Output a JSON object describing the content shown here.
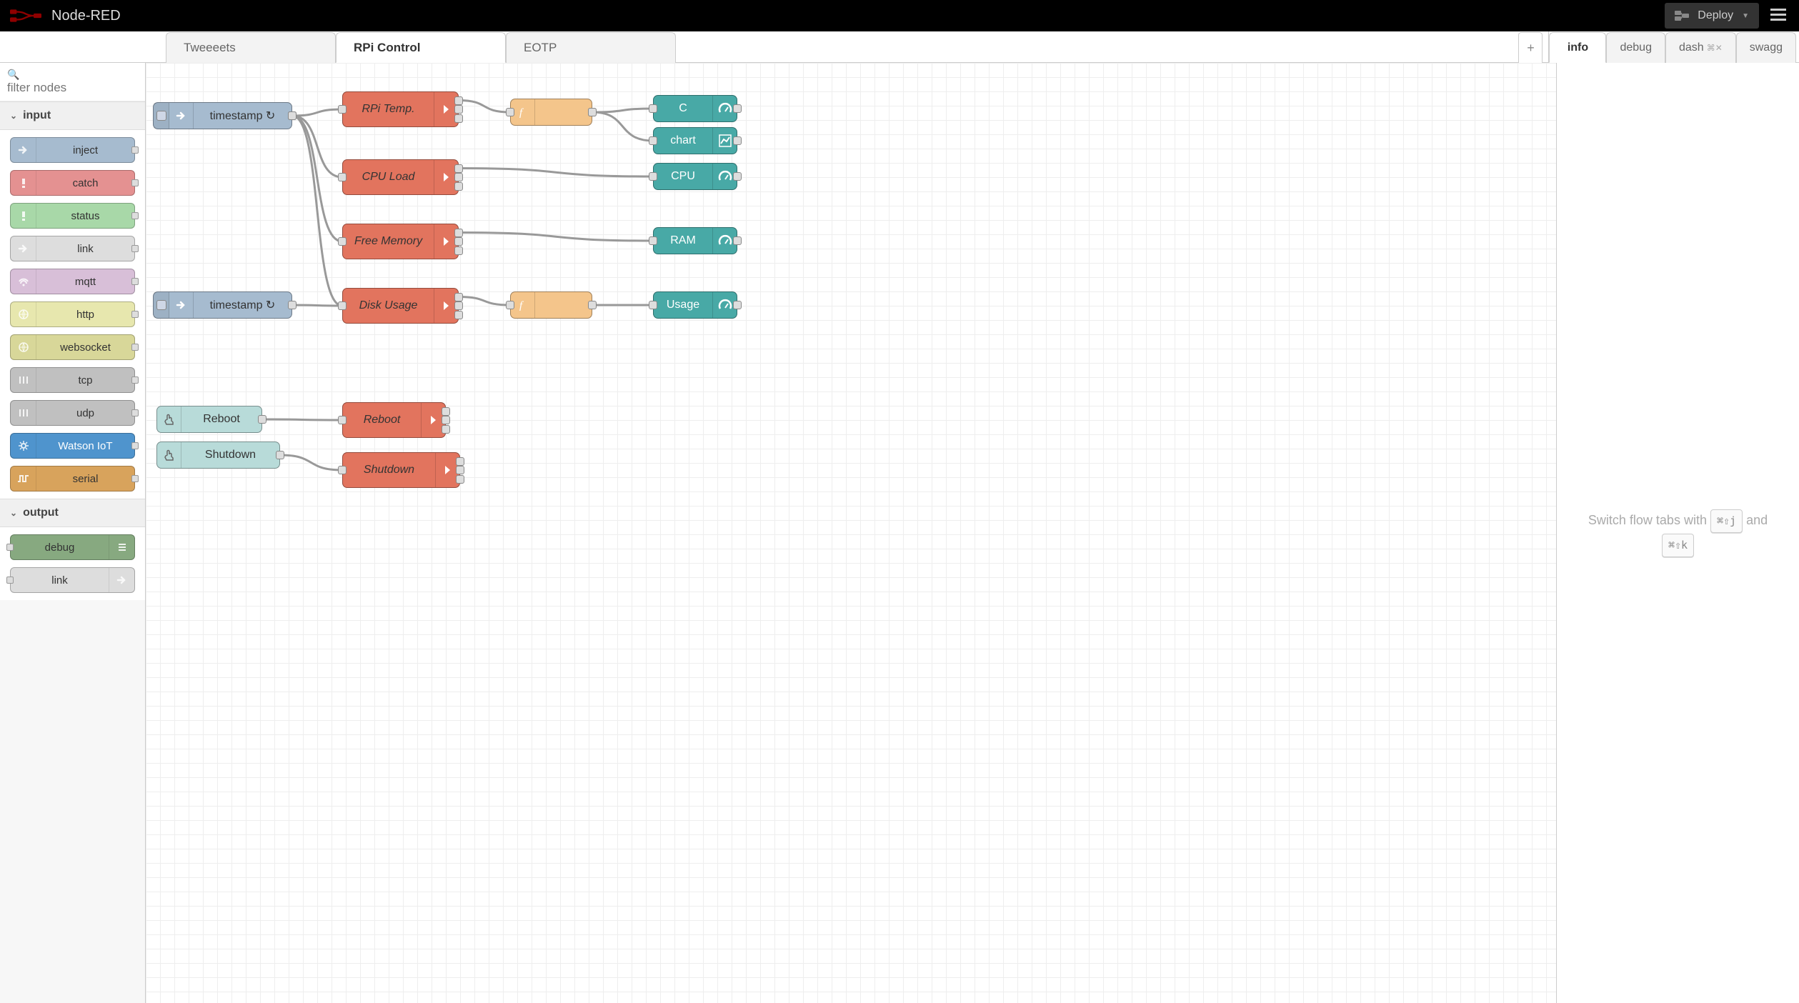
{
  "header": {
    "app_title": "Node-RED",
    "deploy_label": "Deploy"
  },
  "tabs": [
    {
      "label": "Tweeeets",
      "active": false
    },
    {
      "label": "RPi Control",
      "active": true
    },
    {
      "label": "EOTP",
      "active": false
    }
  ],
  "sidebar_tabs": [
    {
      "label": "info",
      "active": true,
      "closable": false
    },
    {
      "label": "debug",
      "active": false,
      "closable": false
    },
    {
      "label": "dash",
      "active": false,
      "closable": true
    },
    {
      "label": "swagg",
      "active": false,
      "closable": false
    }
  ],
  "palette": {
    "filter_placeholder": "filter nodes",
    "categories": [
      {
        "label": "input",
        "items": [
          {
            "label": "inject",
            "color": "c-inject",
            "icon": "arrow",
            "port": "out"
          },
          {
            "label": "catch",
            "color": "c-catch",
            "icon": "bang",
            "port": "out"
          },
          {
            "label": "status",
            "color": "c-status",
            "icon": "bang",
            "port": "out"
          },
          {
            "label": "link",
            "color": "c-link",
            "icon": "arrow",
            "port": "out"
          },
          {
            "label": "mqtt",
            "color": "c-mqtt",
            "icon": "wifi",
            "port": "out"
          },
          {
            "label": "http",
            "color": "c-http",
            "icon": "globe",
            "port": "out"
          },
          {
            "label": "websocket",
            "color": "c-ws",
            "icon": "globe",
            "port": "out"
          },
          {
            "label": "tcp",
            "color": "c-tcp",
            "icon": "net",
            "port": "out"
          },
          {
            "label": "udp",
            "color": "c-udp",
            "icon": "net",
            "port": "out"
          },
          {
            "label": "Watson IoT",
            "color": "c-watson",
            "icon": "gear",
            "port": "out"
          },
          {
            "label": "serial",
            "color": "c-serial",
            "icon": "pulse",
            "port": "out"
          }
        ]
      },
      {
        "label": "output",
        "items": [
          {
            "label": "debug",
            "color": "c-debug",
            "icon": "bars",
            "port": "in",
            "icon_side": "right"
          },
          {
            "label": "link",
            "color": "c-link",
            "icon": "arrow",
            "port": "in",
            "icon_side": "right"
          }
        ]
      }
    ]
  },
  "flow_nodes": {
    "ts1": {
      "label": "timestamp ↻",
      "color": "c-inject",
      "icon": "arrow",
      "italic": false,
      "button": true
    },
    "ts2": {
      "label": "timestamp ↻",
      "color": "c-inject",
      "icon": "arrow",
      "italic": false,
      "button": true
    },
    "temp": {
      "label": "RPi Temp.",
      "color": "c-exec",
      "icon": "chev",
      "italic": true,
      "tall": true,
      "icon_side": "right"
    },
    "cpu": {
      "label": "CPU Load",
      "color": "c-exec",
      "icon": "chev",
      "italic": true,
      "tall": true,
      "icon_side": "right"
    },
    "mem": {
      "label": "Free Memory",
      "color": "c-exec",
      "icon": "chev",
      "italic": true,
      "tall": true,
      "icon_side": "right"
    },
    "disk": {
      "label": "Disk Usage",
      "color": "c-exec",
      "icon": "chev",
      "italic": true,
      "tall": true,
      "icon_side": "right"
    },
    "rebootexec": {
      "label": "Reboot",
      "color": "c-exec",
      "icon": "chev",
      "italic": true,
      "tall": true,
      "icon_side": "right"
    },
    "shutdownexec": {
      "label": "Shutdown",
      "color": "c-exec",
      "icon": "chev",
      "italic": true,
      "tall": true,
      "icon_side": "right"
    },
    "f1": {
      "label": "",
      "color": "c-func",
      "icon": "fx",
      "italic": true
    },
    "f2": {
      "label": "",
      "color": "c-func",
      "icon": "fx",
      "italic": true
    },
    "gC": {
      "label": "C",
      "color": "c-ui",
      "icon": "gauge",
      "icon_side": "right"
    },
    "gChart": {
      "label": "chart",
      "color": "c-ui",
      "icon": "chart",
      "icon_side": "right"
    },
    "gCPU": {
      "label": "CPU",
      "color": "c-ui",
      "icon": "gauge",
      "icon_side": "right"
    },
    "gRAM": {
      "label": "RAM",
      "color": "c-ui",
      "icon": "gauge",
      "icon_side": "right"
    },
    "gUsage": {
      "label": "Usage",
      "color": "c-ui",
      "icon": "gauge",
      "icon_side": "right"
    },
    "rebootbtn": {
      "label": "Reboot",
      "color": "c-uibtn",
      "icon": "hand"
    },
    "shutdownbtn": {
      "label": "Shutdown",
      "color": "c-uibtn",
      "icon": "hand"
    }
  },
  "sidebar_hint": {
    "prefix": "Switch flow tabs with ",
    "kbd1": "⌘⇧j",
    "mid": " and ",
    "kbd2": "⌘⇧k"
  }
}
